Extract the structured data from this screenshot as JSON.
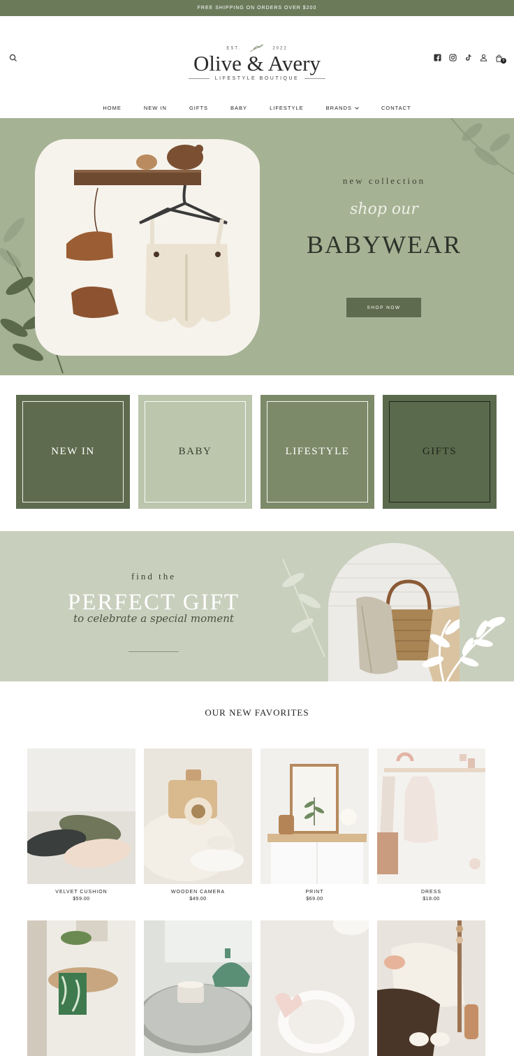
{
  "announcement": "FREE SHIPPING ON ORDERS OVER $200",
  "brand": {
    "est": "EST.",
    "year": "2022",
    "name": "Olive & Avery",
    "tagline": "LIFESTYLE BOUTIQUE"
  },
  "header_icons": [
    "search-icon",
    "facebook-icon",
    "instagram-icon",
    "tiktok-icon",
    "account-icon",
    "bag-icon"
  ],
  "cart_count": "0",
  "nav": {
    "home": "HOME",
    "new_in": "NEW IN",
    "gifts": "GIFTS",
    "baby": "BABY",
    "lifestyle": "LIFESTYLE",
    "brands": "BRANDS",
    "contact": "CONTACT"
  },
  "hero": {
    "subtitle": "new collection",
    "script": "shop our",
    "title": "BABYWEAR",
    "button": "SHOP NOW"
  },
  "tiles": [
    {
      "label": "NEW IN",
      "bg": "#5e6b4e",
      "color": "#ffffff"
    },
    {
      "label": "BABY",
      "bg": "#bcc6ad",
      "color": "#3a3f33"
    },
    {
      "label": "LIFESTYLE",
      "bg": "#7c8a69",
      "color": "#ffffff"
    },
    {
      "label": "GIFTS",
      "bg": "#5a6a4c",
      "color": "#1e241a"
    }
  ],
  "gift": {
    "find": "find the",
    "title": "PERFECT GIFT",
    "script": "to celebrate a special moment"
  },
  "favorites": {
    "title": "OUR NEW FAVORITES",
    "products": [
      {
        "name": "VELVET CUSHION",
        "price": "$59.00"
      },
      {
        "name": "WOODEN CAMERA",
        "price": "$49.00"
      },
      {
        "name": "PRINT",
        "price": "$69.00"
      },
      {
        "name": "DRESS",
        "price": "$18.00"
      }
    ]
  },
  "colors": {
    "sage_dark": "#6b7b5a",
    "hero_bg": "#a5b294",
    "gift_bg": "#c9cfbd",
    "button": "#5e6b4e"
  }
}
